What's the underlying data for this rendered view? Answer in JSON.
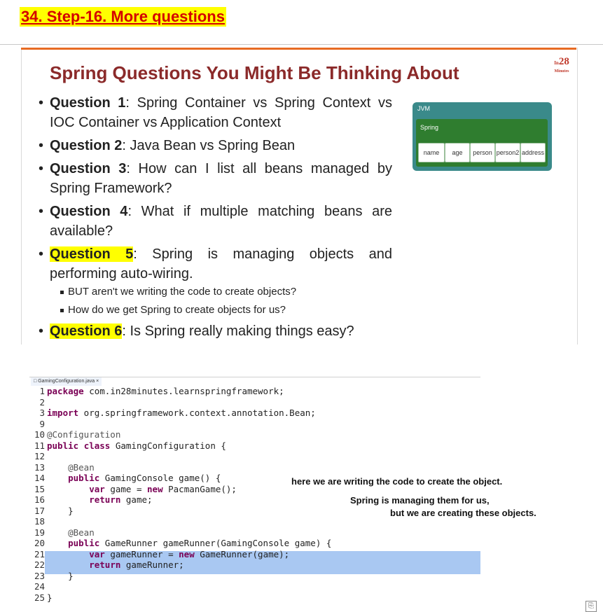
{
  "heading": "34. Step-16. More questions",
  "slide": {
    "title": "Spring Questions You Might Be Thinking About",
    "brand_number": "28",
    "brand_prefix": "In",
    "brand_sub": "Minutes",
    "questions": [
      {
        "label": "Question 1",
        "text": ": Spring Container vs Spring Context vs IOC Container vs Application Context"
      },
      {
        "label": "Question 2",
        "text": ": Java Bean vs Spring Bean"
      },
      {
        "label": "Question 3",
        "text": ": How can I list all beans managed by Spring Framework?"
      },
      {
        "label": "Question 4",
        "text": ": What if multiple matching beans are available?"
      },
      {
        "label": "Question 5",
        "text": ": Spring is managing objects and performing auto-wiring."
      },
      {
        "label": "Question 6",
        "text": ": Is Spring really making things easy?"
      }
    ],
    "sub_bullets": [
      "BUT aren't we writing the code to create objects?",
      "How do we get Spring to create objects for us?"
    ],
    "diagram": {
      "outer_label": "JVM",
      "inner_label": "Spring",
      "beans": [
        "name",
        "age",
        "person",
        "person2",
        "address"
      ],
      "outer_color": "#3a8a8a",
      "inner_color": "#2f7d2f"
    }
  },
  "editor": {
    "tab_label": "GamingConfiguration.java",
    "lines": [
      {
        "n": "1",
        "code": "package com.in28minutes.learnspringframework;"
      },
      {
        "n": "2",
        "code": ""
      },
      {
        "n": "3",
        "code": "import org.springframework.context.annotation.Bean;"
      },
      {
        "n": "9",
        "code": ""
      },
      {
        "n": "10",
        "code": "@Configuration"
      },
      {
        "n": "11",
        "code": "public class GamingConfiguration {"
      },
      {
        "n": "12",
        "code": ""
      },
      {
        "n": "13",
        "code": "    @Bean"
      },
      {
        "n": "14",
        "code": "    public GamingConsole game() {"
      },
      {
        "n": "15",
        "code": "        var game = new PacmanGame();"
      },
      {
        "n": "16",
        "code": "        return game;"
      },
      {
        "n": "17",
        "code": "    }"
      },
      {
        "n": "18",
        "code": ""
      },
      {
        "n": "19",
        "code": "    @Bean"
      },
      {
        "n": "20",
        "code": "    public GameRunner gameRunner(GamingConsole game) {"
      },
      {
        "n": "21",
        "code": "        var gameRunner = new GameRunner(game);"
      },
      {
        "n": "22",
        "code": "        return gameRunner;"
      },
      {
        "n": "23",
        "code": "    }"
      },
      {
        "n": "24",
        "code": ""
      },
      {
        "n": "25",
        "code": "}"
      }
    ],
    "notes": [
      "here we are writing the code to create the object.",
      "Spring is managing them for us,",
      "but we are creating these objects."
    ]
  },
  "colors": {
    "highlight": "#ffff00",
    "heading_text": "#d40000",
    "slide_title": "#8b2a2a",
    "selection": "#a9c8f2"
  }
}
